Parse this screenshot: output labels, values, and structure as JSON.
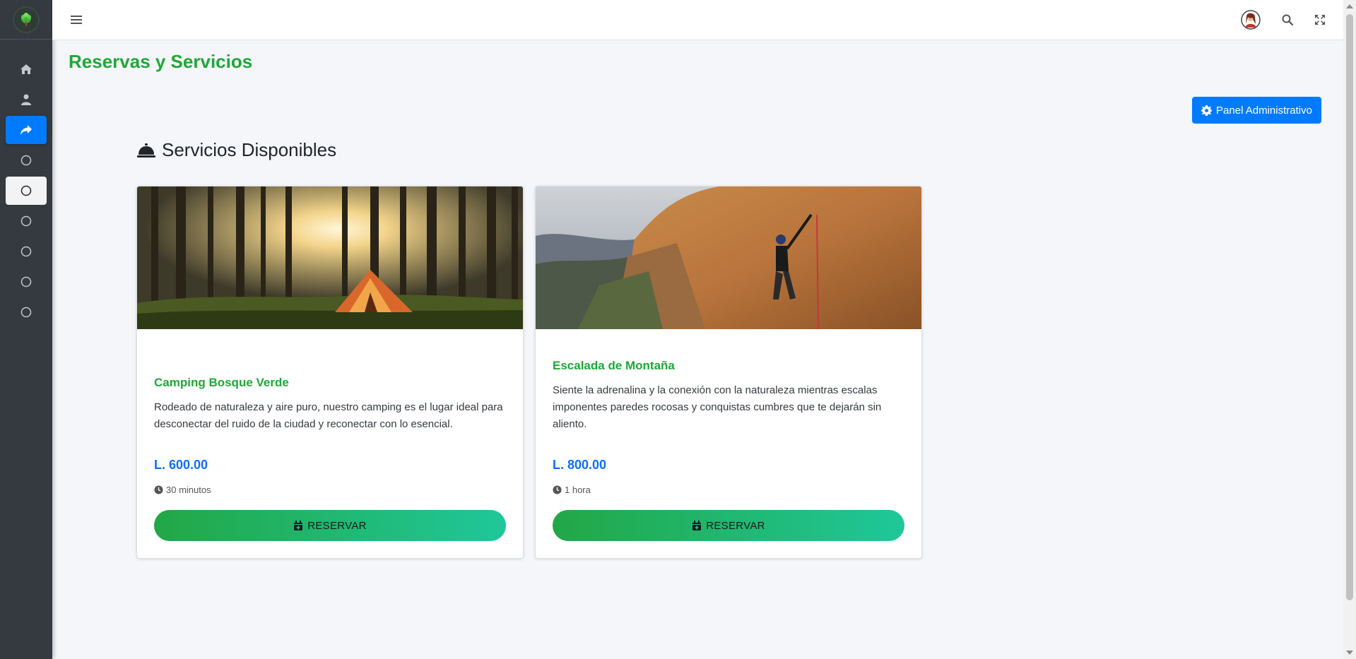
{
  "page": {
    "title": "Reservas y Servicios"
  },
  "header": {
    "admin_button": "Panel Administrativo"
  },
  "section": {
    "title": "Servicios Disponibles"
  },
  "services": [
    {
      "name": "Camping Bosque Verde",
      "description": "Rodeado de naturaleza y aire puro, nuestro camping es el lugar ideal para desconectar del ruido de la ciudad y reconectar con lo esencial.",
      "price": "L. 600.00",
      "duration": "30 minutos",
      "button": "RESERVAR",
      "image": "tent-in-forest"
    },
    {
      "name": "Escalada de Montaña",
      "description": "Siente la adrenalina y la conexión con la naturaleza mientras escalas imponentes paredes rocosas y conquistas cumbres que te dejarán sin aliento.",
      "price": "L. 800.00",
      "duration": "1 hora",
      "button": "RESERVAR",
      "image": "rock-climber-on-cliff"
    }
  ],
  "sidebar": {
    "items": [
      "home-icon",
      "user-icon",
      "share-icon",
      "circle-icon",
      "circle-icon",
      "circle-icon",
      "circle-icon",
      "circle-icon",
      "circle-icon"
    ]
  },
  "colors": {
    "accent": "#1ea838",
    "primary": "#007bff",
    "price": "#0d6efd",
    "sidebar": "#343a40"
  }
}
